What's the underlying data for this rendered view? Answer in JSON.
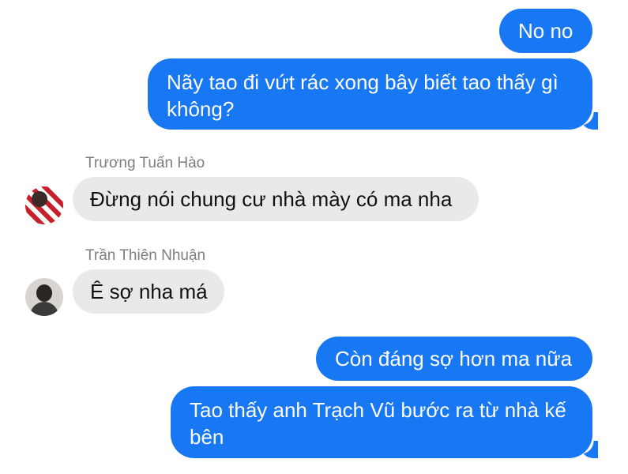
{
  "messages": {
    "m1": "No no",
    "m2": "Nãy tao đi vứt rác xong bây biết tao thấy gì không?",
    "m3_sender": "Trương Tuấn Hào",
    "m3": "Đừng nói chung cư nhà mày có ma nha",
    "m4_sender": "Trần Thiên Nhuận",
    "m4": "Ê sợ nha má",
    "m5": "Còn đáng sợ hơn ma nữa",
    "m6": "Tao thấy anh Trạch Vũ bước ra từ nhà kế bên"
  },
  "colors": {
    "outgoing_bubble": "#1877f2",
    "incoming_bubble": "#e9e9eb",
    "sender_name": "#7d7d82"
  },
  "icons": [
    "avatar-truong-tuan-hao",
    "avatar-tran-thien-nhuan"
  ]
}
